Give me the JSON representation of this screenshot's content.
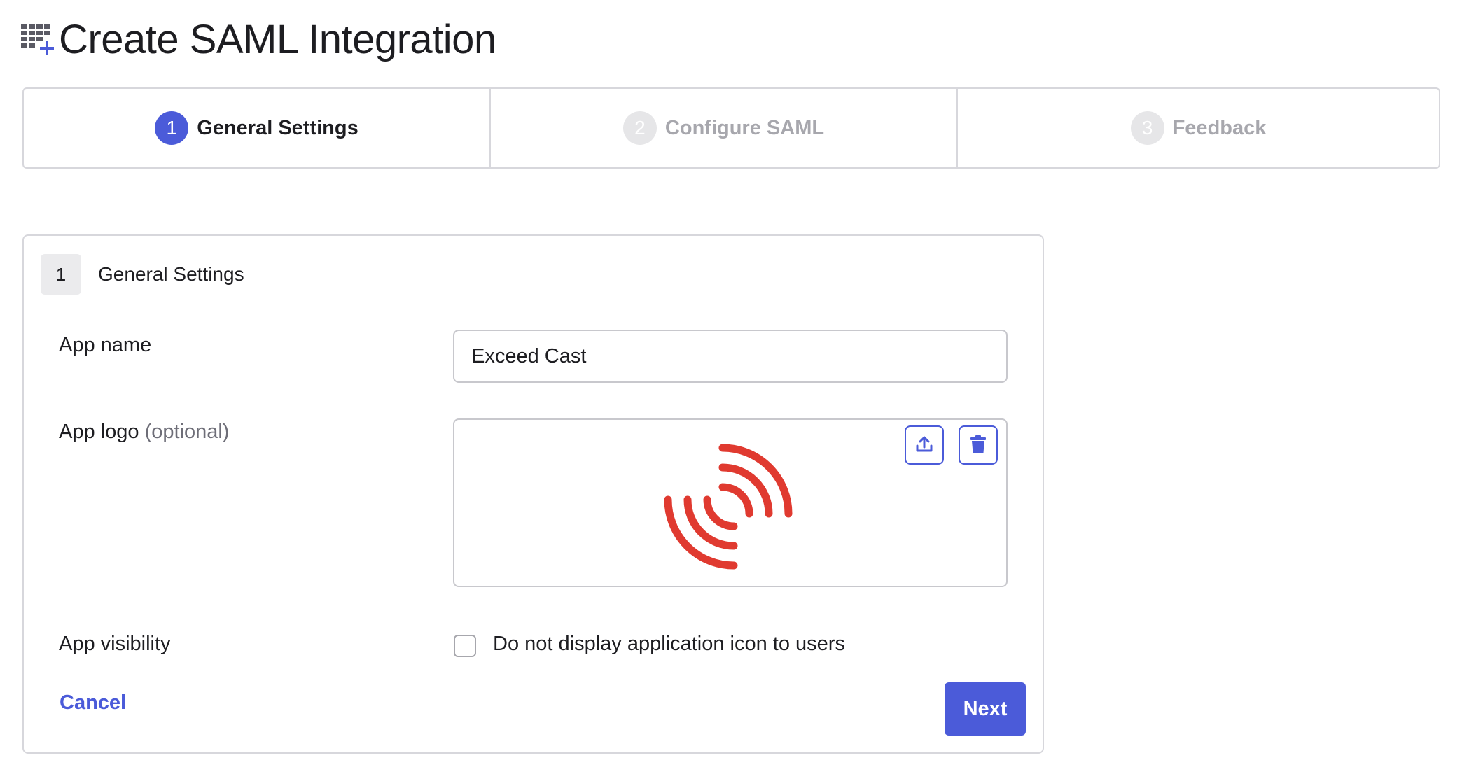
{
  "page": {
    "title": "Create SAML Integration",
    "header_icon": "grid-plus-icon"
  },
  "stepper": {
    "steps": [
      {
        "number": "1",
        "label": "General Settings",
        "state": "active"
      },
      {
        "number": "2",
        "label": "Configure SAML",
        "state": "inactive"
      },
      {
        "number": "3",
        "label": "Feedback",
        "state": "inactive"
      }
    ]
  },
  "card": {
    "step_number": "1",
    "title": "General Settings",
    "app_name": {
      "label": "App name",
      "value": "Exceed Cast"
    },
    "app_logo": {
      "label": "App logo",
      "optional_label": "(optional)",
      "upload_icon": "upload-icon",
      "delete_icon": "trash-icon",
      "logo_icon": "broadcast-signal-icon"
    },
    "app_visibility": {
      "label": "App visibility",
      "checkbox_label": "Do not display application icon to users",
      "checked": false
    },
    "cancel_label": "Cancel",
    "next_label": "Next"
  },
  "colors": {
    "accent": "#4b5bd9",
    "logo_red": "#e03a30",
    "border": "#d7d7dc",
    "text": "#1d1d21",
    "muted": "#a7a7ad"
  }
}
